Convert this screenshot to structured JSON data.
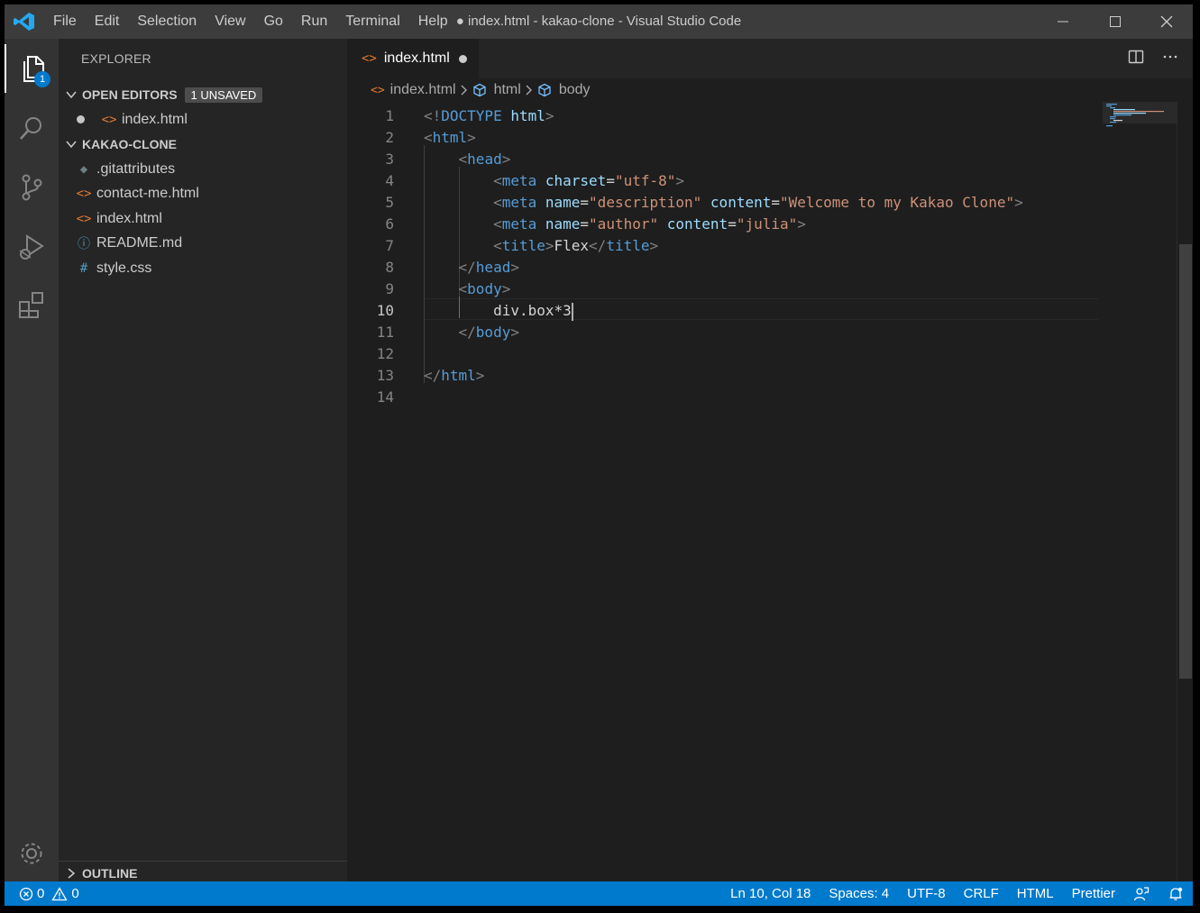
{
  "window": {
    "title": "● index.html - kakao-clone - Visual Studio Code",
    "menu": [
      "File",
      "Edit",
      "Selection",
      "View",
      "Go",
      "Run",
      "Terminal",
      "Help"
    ]
  },
  "activity": {
    "explorer_badge": "1"
  },
  "sidebar": {
    "title": "EXPLORER",
    "open_editors": {
      "label": "OPEN EDITORS",
      "badge": "1 UNSAVED",
      "items": [
        {
          "name": "index.html",
          "icon": "<>",
          "modified": true
        }
      ]
    },
    "project": {
      "label": "KAKAO-CLONE",
      "files": [
        {
          "name": ".gitattributes",
          "icon": "◆"
        },
        {
          "name": "contact-me.html",
          "icon": "<>"
        },
        {
          "name": "index.html",
          "icon": "<>"
        },
        {
          "name": "README.md",
          "icon": "ⓘ"
        },
        {
          "name": "style.css",
          "icon": "#"
        }
      ]
    },
    "outline": {
      "label": "OUTLINE"
    }
  },
  "editor": {
    "tab": {
      "label": "index.html",
      "icon": "<>",
      "modified": true
    },
    "breadcrumbs": [
      "index.html",
      "html",
      "body"
    ],
    "line_numbers": [
      "1",
      "2",
      "3",
      "4",
      "5",
      "6",
      "7",
      "8",
      "9",
      "10",
      "11",
      "12",
      "13",
      "14"
    ],
    "current_line": 10
  },
  "colors": {
    "accent": "#007acc",
    "tag": "#569cd6",
    "attribute": "#9cdcfe",
    "string": "#ce9178",
    "html_icon": "#e37933"
  },
  "status": {
    "errors": "0",
    "warnings": "0",
    "position": "Ln 10, Col 18",
    "spaces": "Spaces: 4",
    "encoding": "UTF-8",
    "eol": "CRLF",
    "language": "HTML",
    "formatter": "Prettier"
  }
}
